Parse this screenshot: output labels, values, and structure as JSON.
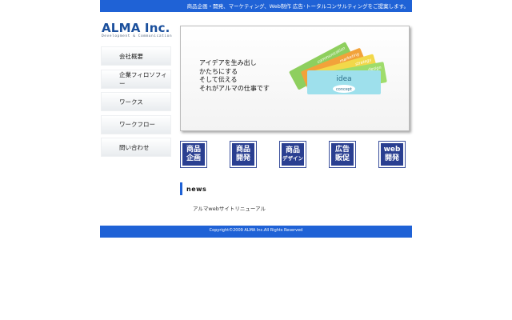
{
  "header": {
    "tagline": "商品企画・開発、マーケティング、Web制作 広告･トータルコンサルティングをご提案します。"
  },
  "logo": {
    "title": "ALMA Inc.",
    "subtitle": "Development & Communication"
  },
  "nav": {
    "items": [
      {
        "label": "会社概要"
      },
      {
        "label": "企業フィロソフィー"
      },
      {
        "label": "ワークス"
      },
      {
        "label": "ワークフロー"
      },
      {
        "label": "問い合わせ"
      }
    ]
  },
  "hero": {
    "lines": [
      "アイデアを生み出し",
      "かたちにする",
      "そして伝える",
      "それがアルマの仕事です"
    ],
    "cards": [
      {
        "label": "communication",
        "color": "#8ecf5e"
      },
      {
        "label": "marketing",
        "color": "#f2a23a"
      },
      {
        "label": "strategy",
        "color": "#f2d84a"
      },
      {
        "label": "design",
        "color": "#9fdc6b"
      }
    ],
    "idea_label": "idea",
    "concept_label": "concept",
    "idea_color": "#9ee0ec"
  },
  "buttons": [
    {
      "line1": "商品",
      "line2": "企画"
    },
    {
      "line1": "商品",
      "line2": "開発"
    },
    {
      "line1": "商品",
      "line2": "デザイン"
    },
    {
      "line1": "広告",
      "line2": "販促"
    },
    {
      "line1": "web",
      "line2": "開発"
    }
  ],
  "news": {
    "heading": "news",
    "items": [
      {
        "text": "アルマwebサイトリニューアル"
      }
    ]
  },
  "footer": {
    "copyright": "Copyright©2009 ALMA Inc.All Rights Reserved"
  }
}
